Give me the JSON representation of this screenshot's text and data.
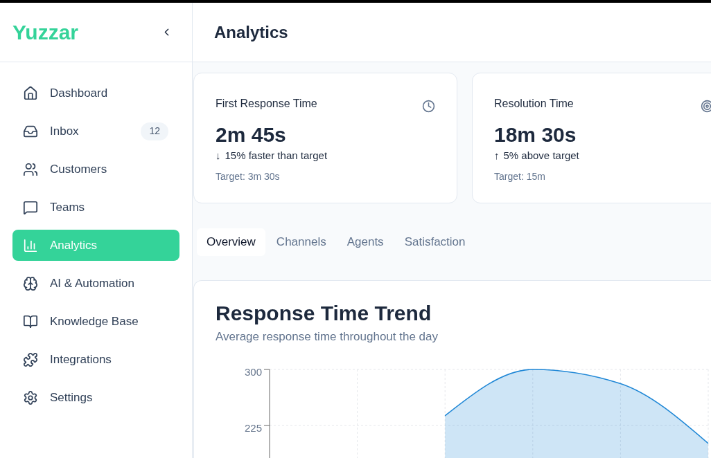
{
  "sidebar": {
    "logo": "Yuzzar",
    "items": [
      {
        "label": "Dashboard",
        "selected": false
      },
      {
        "label": "Inbox",
        "selected": false,
        "badge": "12"
      },
      {
        "label": "Customers",
        "selected": false
      },
      {
        "label": "Teams",
        "selected": false
      },
      {
        "label": "Analytics",
        "selected": true
      },
      {
        "label": "AI & Automation",
        "selected": false
      },
      {
        "label": "Knowledge Base",
        "selected": false
      },
      {
        "label": "Integrations",
        "selected": false
      },
      {
        "label": "Settings",
        "selected": false
      }
    ]
  },
  "header": {
    "title": "Analytics"
  },
  "metrics": [
    {
      "title": "First Response Time",
      "value": "2m 45s",
      "arrow": "↓",
      "change": "15% faster than target",
      "target": "Target: 3m 30s"
    },
    {
      "title": "Resolution Time",
      "value": "18m 30s",
      "arrow": "↑",
      "change": "5% above target",
      "target": "Target: 15m"
    }
  ],
  "tabs": [
    {
      "label": "Overview",
      "selected": true
    },
    {
      "label": "Channels",
      "selected": false
    },
    {
      "label": "Agents",
      "selected": false
    },
    {
      "label": "Satisfaction",
      "selected": false
    }
  ],
  "chart_card": {
    "title": "Response Time Trend",
    "subtitle": "Average response time throughout the day",
    "chart_data": {
      "type": "area",
      "ylim": [
        180,
        300
      ],
      "yticks": [
        300,
        225
      ],
      "grid": true,
      "series": [
        {
          "color": "#1f87d6",
          "values": [
            null,
            null,
            238,
            300,
            281,
            201
          ]
        }
      ]
    }
  }
}
